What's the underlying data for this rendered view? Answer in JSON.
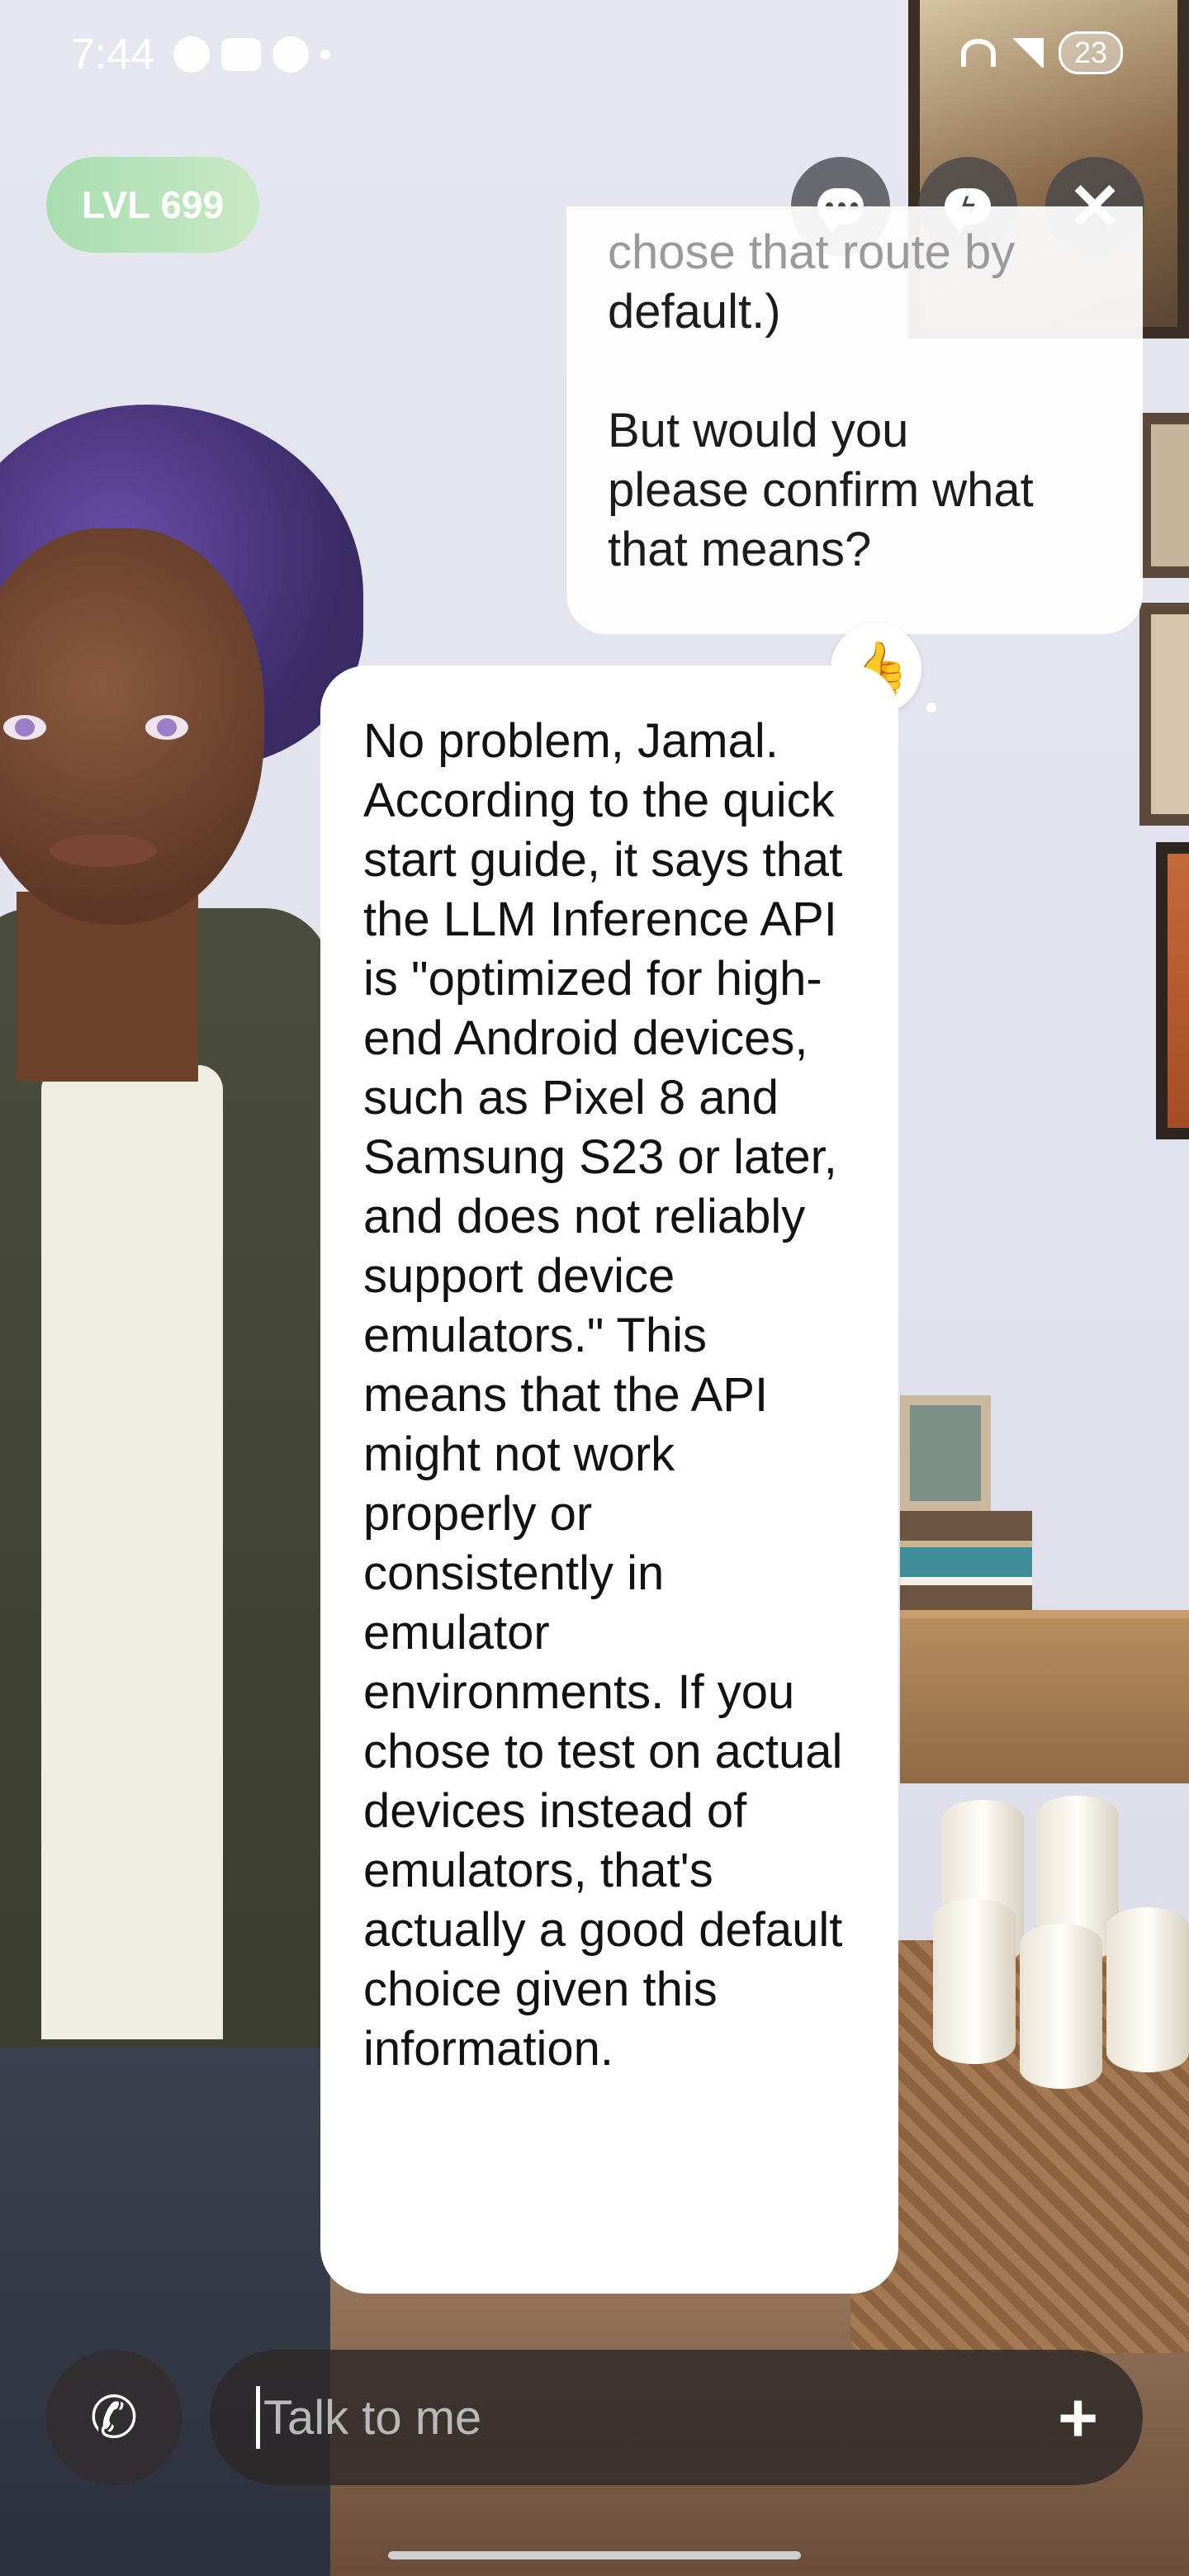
{
  "status_bar": {
    "time": "7:44",
    "battery": "23"
  },
  "header": {
    "level_badge": "LVL 699",
    "icons": [
      "chat-bubble-icon",
      "voice-chat-bubble-icon",
      "close-icon"
    ]
  },
  "chat": {
    "user_message_partial_hidden": "chose that route by",
    "user_message_lines": [
      "default.)",
      "",
      "But would you",
      "please confirm what",
      "that means?"
    ],
    "reaction": "👍",
    "ai_message": "No problem, Jamal. According to the quick start guide, it says that the LLM Inference API is \"optimized for high-end Android devices, such as Pixel 8 and Samsung S23 or later, and does not reliably support device emulators.\" This means that the API might not work properly or consistently in emulator environments. If you chose to test on actual devices instead of emulators, that's actually a good default choice given this information."
  },
  "composer": {
    "placeholder": "Talk to me",
    "icons": [
      "phone-icon",
      "plus-icon"
    ]
  }
}
